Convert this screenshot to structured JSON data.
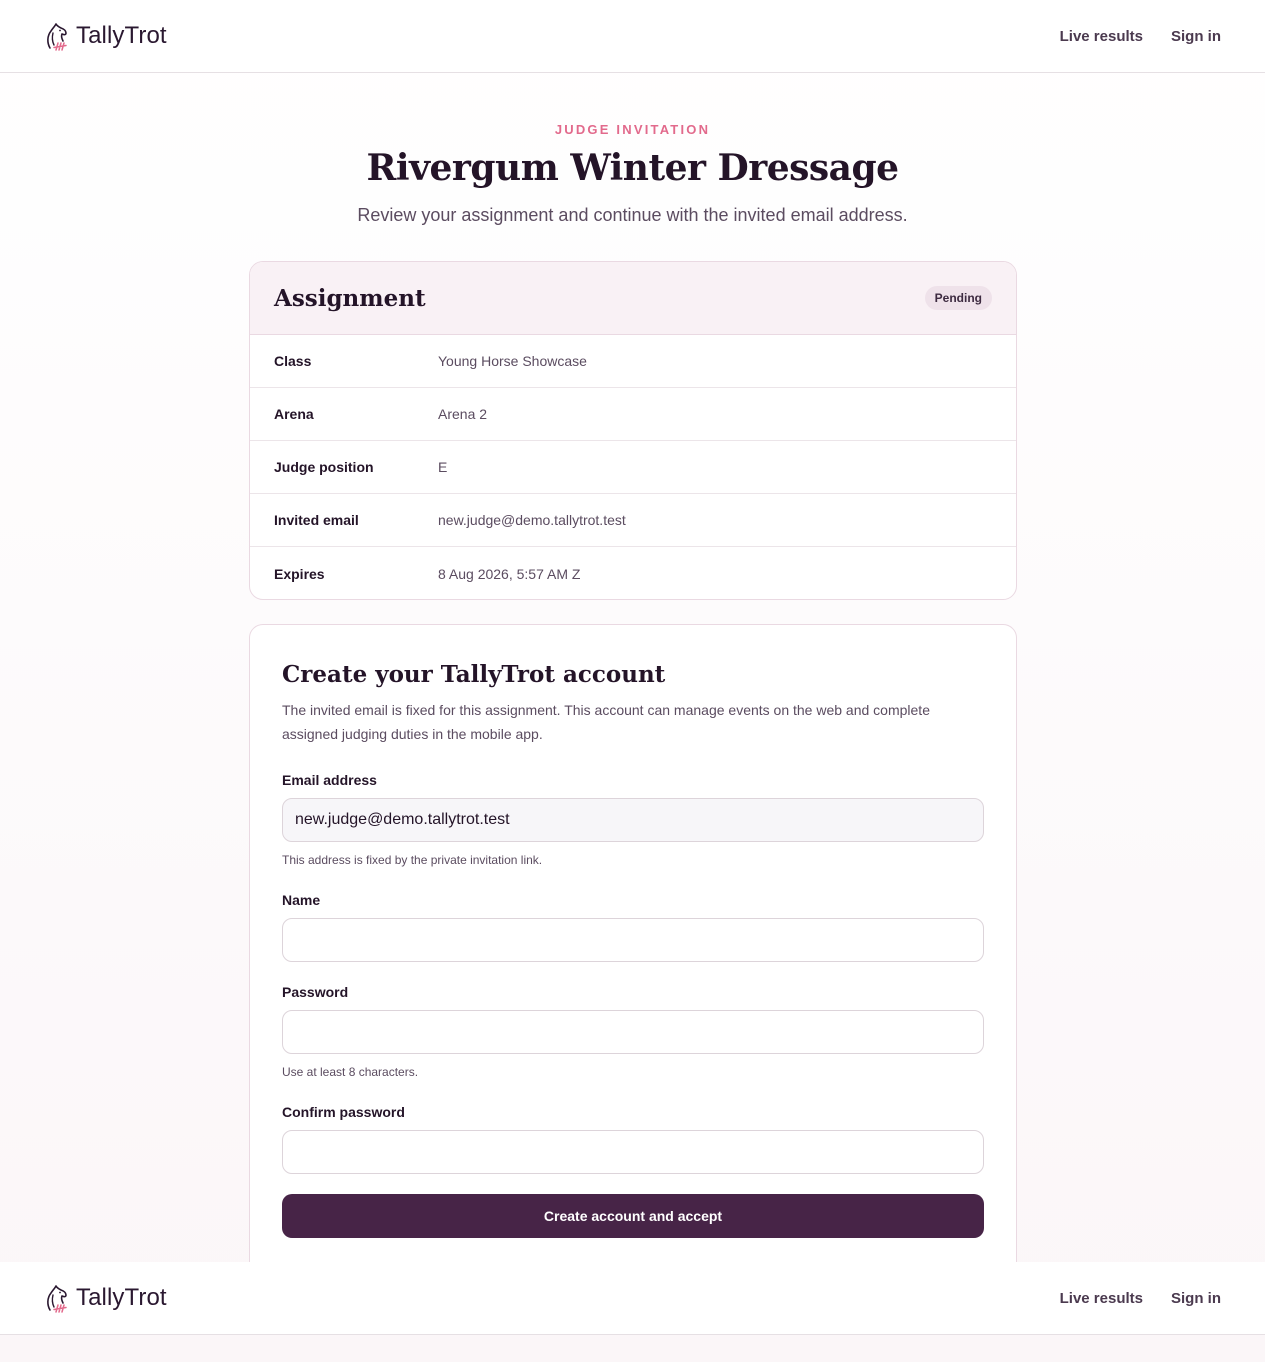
{
  "header": {
    "brand": "TallyTrot",
    "nav": [
      {
        "label": "Live results"
      },
      {
        "label": "Sign in"
      }
    ]
  },
  "hero": {
    "eyebrow": "JUDGE INVITATION",
    "title": "Rivergum Winter Dressage",
    "subtitle": "Review your assignment and continue with the invited email address."
  },
  "assignment": {
    "heading": "Assignment",
    "status": "Pending",
    "rows": [
      {
        "label": "Class",
        "value": "Young Horse Showcase"
      },
      {
        "label": "Arena",
        "value": "Arena 2"
      },
      {
        "label": "Judge position",
        "value": "E"
      },
      {
        "label": "Invited email",
        "value": "new.judge@demo.tallytrot.test"
      },
      {
        "label": "Expires",
        "value": "8 Aug 2026, 5:57 AM Z"
      }
    ]
  },
  "form": {
    "heading": "Create your TallyTrot account",
    "intro": "The invited email is fixed for this assignment. This account can manage events on the web and complete assigned judging duties in the mobile app.",
    "email": {
      "label": "Email address",
      "value": "new.judge@demo.tallytrot.test",
      "help": "This address is fixed by the private invitation link."
    },
    "name": {
      "label": "Name",
      "value": ""
    },
    "password": {
      "label": "Password",
      "value": "",
      "help": "Use at least 8 characters."
    },
    "confirm": {
      "label": "Confirm password",
      "value": ""
    },
    "submit_label": "Create account and accept"
  },
  "colors": {
    "accent": "#e26a8c",
    "primary_button": "#472447",
    "heading": "#241428"
  }
}
